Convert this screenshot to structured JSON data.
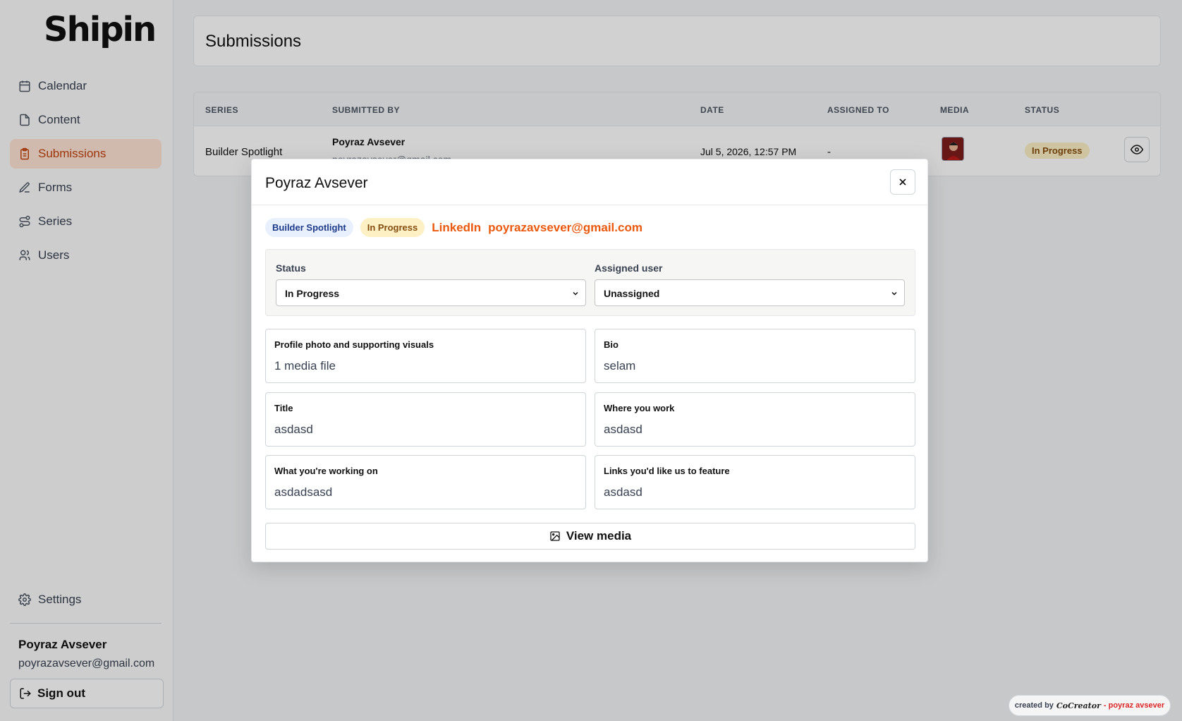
{
  "app": {
    "logo": "Shipin"
  },
  "sidebar": {
    "items": [
      {
        "label": "Calendar",
        "icon": "calendar-icon"
      },
      {
        "label": "Content",
        "icon": "document-icon"
      },
      {
        "label": "Submissions",
        "icon": "clipboard-icon",
        "active": true
      },
      {
        "label": "Forms",
        "icon": "edit-form-icon"
      },
      {
        "label": "Series",
        "icon": "route-icon"
      },
      {
        "label": "Users",
        "icon": "users-icon"
      }
    ],
    "settings_label": "Settings",
    "user": {
      "name": "Poyraz Avsever",
      "email": "poyrazavsever@gmail.com"
    },
    "signout_label": "Sign out"
  },
  "page": {
    "title": "Submissions"
  },
  "table": {
    "headers": [
      "SERIES",
      "SUBMITTED BY",
      "DATE",
      "ASSIGNED TO",
      "MEDIA",
      "STATUS"
    ],
    "rows": [
      {
        "series": "Builder Spotlight",
        "submitter_name": "Poyraz Avsever",
        "submitter_email": "poyrazavsever@gmail.com",
        "date": "Jul 5, 2026, 12:57 PM",
        "assigned_to": "-",
        "status": "In Progress"
      }
    ]
  },
  "modal": {
    "title": "Poyraz Avsever",
    "tags": {
      "series": "Builder Spotlight",
      "status": "In Progress"
    },
    "links": {
      "linkedin": "LinkedIn",
      "email": "poyrazavsever@gmail.com"
    },
    "status_label": "Status",
    "status_value": "In Progress",
    "assigned_label": "Assigned user",
    "assigned_value": "Unassigned",
    "fields": [
      {
        "label": "Profile photo and supporting visuals",
        "value": "1 media file"
      },
      {
        "label": "Bio",
        "value": "selam"
      },
      {
        "label": "Title",
        "value": "asdasd"
      },
      {
        "label": "Where you work",
        "value": "asdasd"
      },
      {
        "label": "What you're working on",
        "value": "asdadsasd"
      },
      {
        "label": "Links you'd like us to feature",
        "value": "asdasd"
      }
    ],
    "view_media_label": "View media"
  },
  "credit": {
    "prefix": "created by",
    "brand": "CoCreator",
    "author": "- poyraz avsever"
  },
  "colors": {
    "accent": "#ea580c",
    "active_bg": "#fde3d3",
    "active_text": "#c2410c",
    "status_bg": "#fdf0c5",
    "status_text": "#854d0e"
  }
}
